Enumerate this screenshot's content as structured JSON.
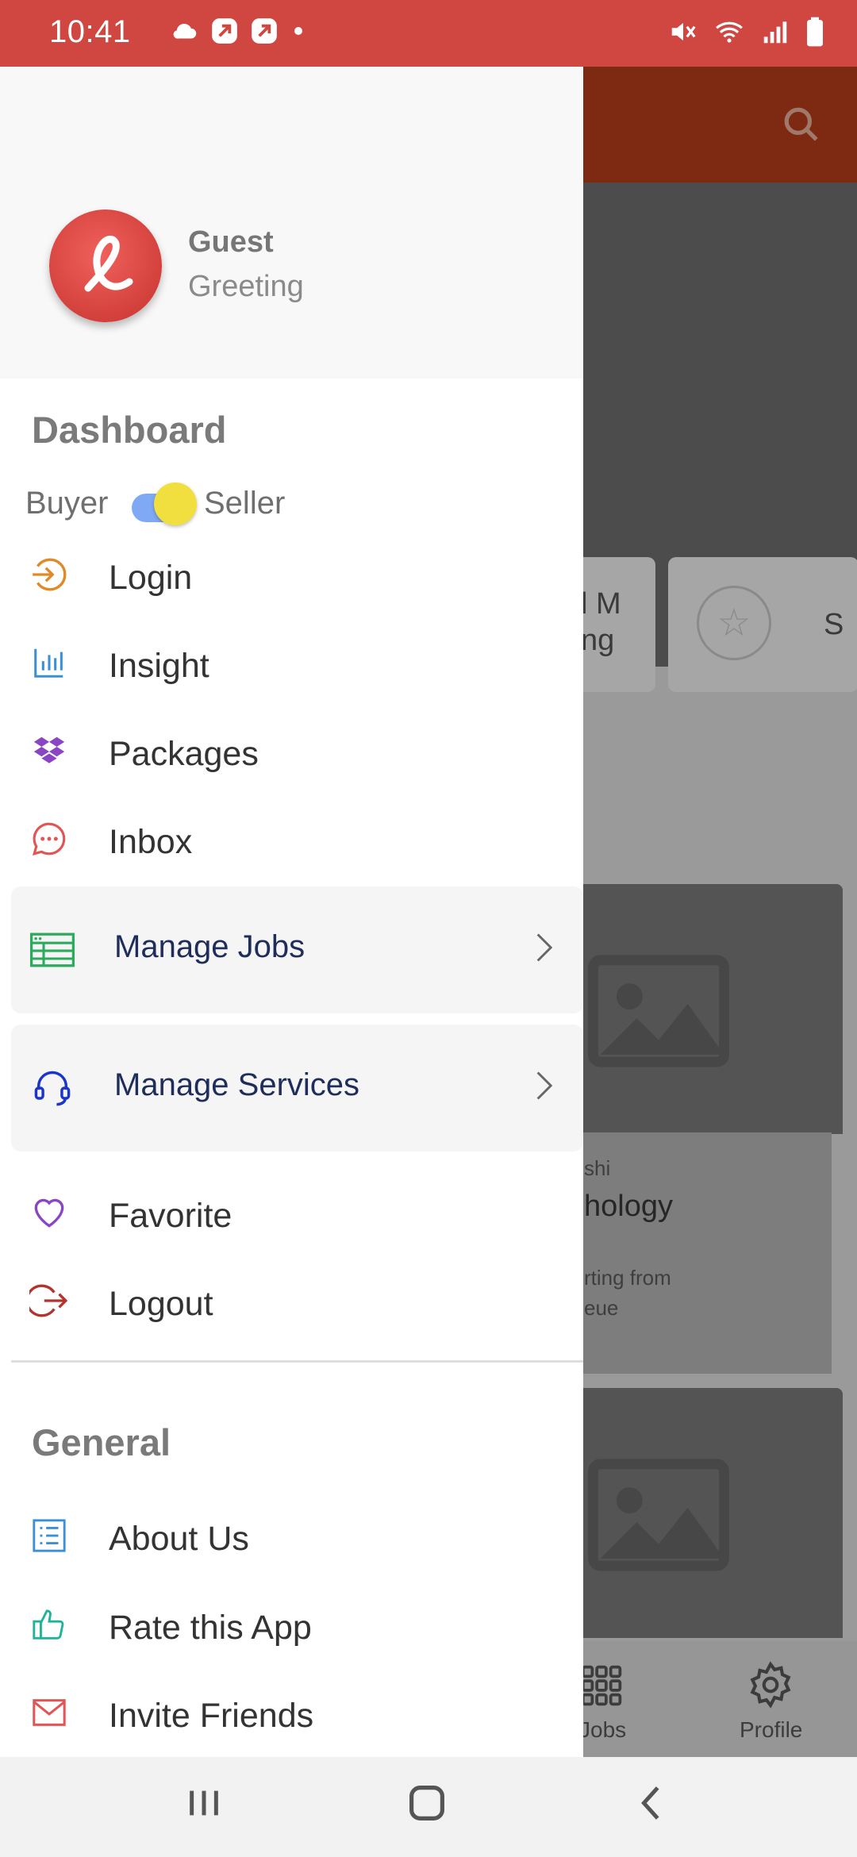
{
  "status_bar": {
    "time": "10:41",
    "color": "#d04641",
    "left_icons": [
      "cloud-icon",
      "app-icon",
      "app-icon",
      "dot-icon"
    ],
    "right_icons": [
      "mute-icon",
      "wifi-icon",
      "signal-icon",
      "battery-icon"
    ]
  },
  "drawer": {
    "user": {
      "name": "Guest",
      "subtitle": "Greeting"
    },
    "dashboard": {
      "title": "Dashboard",
      "toggle": {
        "left_label": "Buyer",
        "right_label": "Seller",
        "state": "seller"
      },
      "items": [
        {
          "label": "Login",
          "icon": "login-icon",
          "color": "#e08a27"
        },
        {
          "label": "Insight",
          "icon": "chart-icon",
          "color": "#3b8fd6"
        },
        {
          "label": "Packages",
          "icon": "dropbox-icon",
          "color": "#8a45c4"
        },
        {
          "label": "Inbox",
          "icon": "chat-icon",
          "color": "#e25555"
        }
      ],
      "expandables": [
        {
          "label": "Manage Jobs",
          "icon": "jobs-table-icon",
          "color": "#2eaa5e"
        },
        {
          "label": "Manage Services",
          "icon": "headset-icon",
          "color": "#1b34c9"
        }
      ],
      "items_after": [
        {
          "label": "Favorite",
          "icon": "heart-icon",
          "color": "#8a45c4"
        },
        {
          "label": "Logout",
          "icon": "logout-icon",
          "color": "#b4332c"
        }
      ]
    },
    "general": {
      "title": "General",
      "items": [
        {
          "label": "About Us",
          "icon": "list-icon",
          "color": "#3b8fd6"
        },
        {
          "label": "Rate this App",
          "icon": "thumbs-up-icon",
          "color": "#1fb39a"
        },
        {
          "label": "Invite Friends",
          "icon": "mail-icon",
          "color": "#e25555"
        }
      ]
    }
  },
  "background": {
    "appbar_color": "#7e2a12",
    "category_1_line1": "l M",
    "category_1_line2": "ng",
    "category_2_label": "S",
    "card": {
      "author": "shi",
      "title": "hology",
      "price_line1": "rting from",
      "price_line2": "eue"
    },
    "bottom_nav": {
      "jobs": "Jobs",
      "profile": "Profile"
    }
  },
  "nav_bar": {
    "buttons": [
      "recents-button",
      "home-button",
      "back-button"
    ]
  }
}
